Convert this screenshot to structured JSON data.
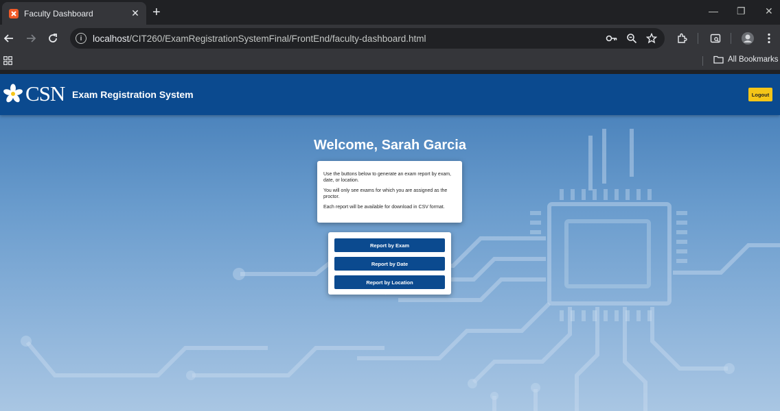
{
  "browser": {
    "tab_title": "Faculty Dashboard",
    "url_host": "localhost",
    "url_path": "/CIT260/ExamRegistrationSystemFinal/FrontEnd/faculty-dashboard.html",
    "bookmarks_label": "All Bookmarks",
    "window_controls": {
      "minimize": "—",
      "restore": "❐",
      "close": "✕"
    }
  },
  "header": {
    "logo_text": "CSN",
    "site_title": "Exam Registration System",
    "logout_label": "Logout"
  },
  "main": {
    "welcome": "Welcome, Sarah Garcia",
    "info": [
      "Use the buttons below to generate an exam report by exam, date, or location.",
      "You will only see exams for which you are assigned as the proctor.",
      "Each report will be available for download in CSV format."
    ],
    "buttons": {
      "by_exam": "Report by Exam",
      "by_date": "Report by Date",
      "by_location": "Report by Location"
    }
  },
  "colors": {
    "header_bg": "#0b4a8f",
    "button_bg": "#0b4a8f",
    "logout_bg": "#f5c518"
  },
  "icons": [
    "xampp-favicon",
    "close-icon",
    "plus-icon",
    "back-arrow-icon",
    "forward-arrow-icon",
    "reload-icon",
    "info-icon",
    "key-icon",
    "zoom-icon",
    "star-icon",
    "extensions-icon",
    "tab-search-icon",
    "profile-avatar-icon",
    "kebab-menu-icon",
    "apps-grid-icon",
    "folder-icon",
    "flower-logo-icon"
  ]
}
